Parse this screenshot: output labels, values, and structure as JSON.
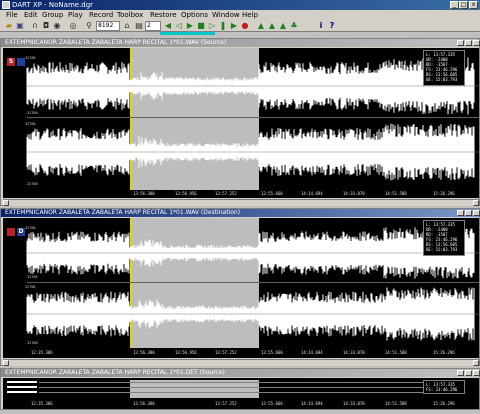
{
  "window": {
    "title": "DART XP - NoName.dgr",
    "minimize": "_",
    "maximize": "□",
    "close": "x"
  },
  "menu": [
    "File",
    "Edit",
    "Group",
    "Play",
    "Record",
    "Toolbox",
    "Restore",
    "Options",
    "Window",
    "Help"
  ],
  "toolbar": {
    "zoom_value": "8192",
    "channel_value": "2",
    "info_label": "i",
    "help_label": "?"
  },
  "source_panel": {
    "title": "EXTEMPNICANOR ZABALETA ZABALETA HARP RECITAL 1*01.WAV (Source)",
    "badge": "S",
    "info": [
      "L:  13:57.335",
      "UR: -2400",
      "RD: -3587",
      "FS:  23:46.296",
      "BS:  13:56.605",
      "OE:  15:03.793"
    ],
    "y_labels": [
      "32768",
      "-32768",
      "32768",
      "-32768"
    ],
    "ticks": [
      "13:56.380",
      "13:56.956",
      "13:57.252",
      "13:55.660",
      "14:14.694",
      "14:33.070",
      "14:51.588",
      "15:26.296"
    ]
  },
  "dest_panel": {
    "title": "EXTEMPNICANOR ZABALETA ZABALETA HARP RECITAL 1*01.WAV (Destination)",
    "badge": "D",
    "info": [
      "L:  13:57.335",
      "UR: -2400",
      "RD: -3587",
      "FS:  23:46.296",
      "BS:  13:56.605",
      "OE:  15:03.793"
    ],
    "y_labels": [
      "32768",
      "-32768",
      "32768",
      "-32768"
    ],
    "ticks": [
      "12:35.386",
      "13:56.380",
      "13:56.956",
      "13:57.252",
      "13:55.660",
      "14:14.694",
      "14:33.070",
      "14:51.588",
      "15:26.296"
    ]
  },
  "bottom_panel": {
    "title": "EXTEMPNICANOR ZABALETA ZABALETA HARP RECITAL 1*01.DET (Source)",
    "info": [
      "L:  13:57.335",
      "FS:  23:46.296"
    ],
    "ticks": [
      "12:35.386",
      "13:56.380",
      "13:57.252",
      "13:55.660",
      "14:14.694",
      "14:33.070",
      "14:51.588",
      "15:26.296"
    ]
  },
  "colors": {
    "selection": "#bdbdbd",
    "waveform": "#ffffff",
    "source_badge": "#c02020",
    "dest_badge": "#2040a0",
    "cursor": "#e6d400"
  }
}
